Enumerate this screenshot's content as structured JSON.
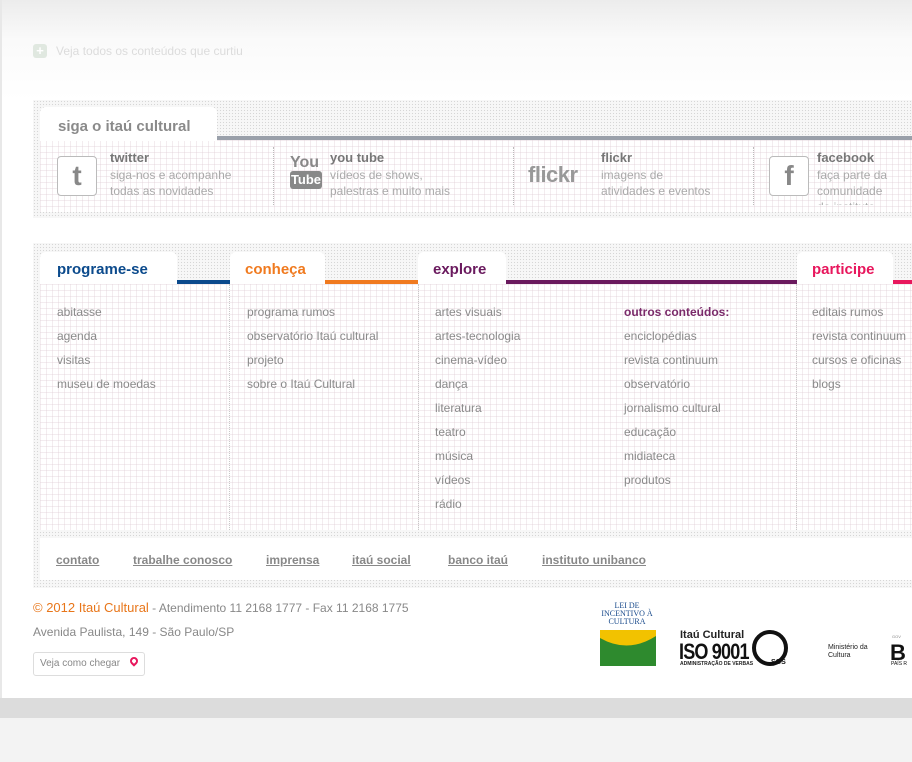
{
  "curtiu": {
    "icon": "plus-icon",
    "text": "Veja todos os conteúdos que curtiu"
  },
  "siga": {
    "title": "siga o itaú cultural",
    "items": [
      {
        "icon": "twitter-icon",
        "title": "twitter",
        "desc": "siga-nos e acompanhe\ntodas as novidades"
      },
      {
        "icon": "youtube-icon",
        "title": "you tube",
        "desc": "vídeos de shows,\npalestras e muito mais"
      },
      {
        "icon": "flickr-icon",
        "title": "flickr",
        "desc": "imagens de\natividades e eventos"
      },
      {
        "icon": "facebook-icon",
        "title": "facebook",
        "desc": "faça parte da comunidade\ndo instituto"
      }
    ],
    "youtube_icon_text": {
      "you": "You",
      "tube": "Tube"
    },
    "flickr_icon_text": "flickr"
  },
  "nav": {
    "programe": {
      "title": "programe-se",
      "color": "#0b4a8c",
      "links": [
        "abitasse",
        "agenda",
        "visitas",
        "museu de moedas"
      ]
    },
    "conheca": {
      "title": "conheça",
      "color": "#f07a1f",
      "links": [
        "programa rumos",
        "observatório Itaú cultural",
        "projeto",
        "sobre o Itaú Cultural"
      ]
    },
    "explore": {
      "title": "explore",
      "color": "#6a1a5e",
      "links": [
        "artes visuais",
        "artes-tecnologia",
        "cinema-vídeo",
        "dança",
        "literatura",
        "teatro",
        "música",
        "vídeos",
        "rádio"
      ],
      "outros_title": "outros conteúdos:",
      "outros": [
        "enciclopédias",
        "revista continuum",
        "observatório",
        "jornalismo cultural",
        "educação",
        "midiateca",
        "produtos"
      ]
    },
    "participe": {
      "title": "participe",
      "color": "#e8175d",
      "links": [
        "editais rumos",
        "revista continuum",
        "cursos e oficinas",
        "blogs"
      ]
    }
  },
  "footer_links": [
    "contato",
    "trabalhe conosco",
    "imprensa",
    "itaú social",
    "banco itaú",
    "instituto unibanco"
  ],
  "footer": {
    "copyright": "© 2012 Itaú Cultural",
    "atendimento": " - Atendimento 11 2168 1777 - Fax 11 2168 1775",
    "address": "Avenida Paulista, 149 - São Paulo/SP",
    "como_chegar": "Veja como chegar",
    "lei": "LEI DE INCENTIVO À CULTURA",
    "iso_title": "Itaú Cultural",
    "iso_num": "ISO 9001",
    "iso_sub": "ADMINISTRAÇÃO DE VERBAS",
    "sgs": "SGS",
    "ministerio": "Ministério da\nCultura",
    "gov": "GOV",
    "brasil": "B",
    "brasil_sub": "PAÍS R"
  }
}
